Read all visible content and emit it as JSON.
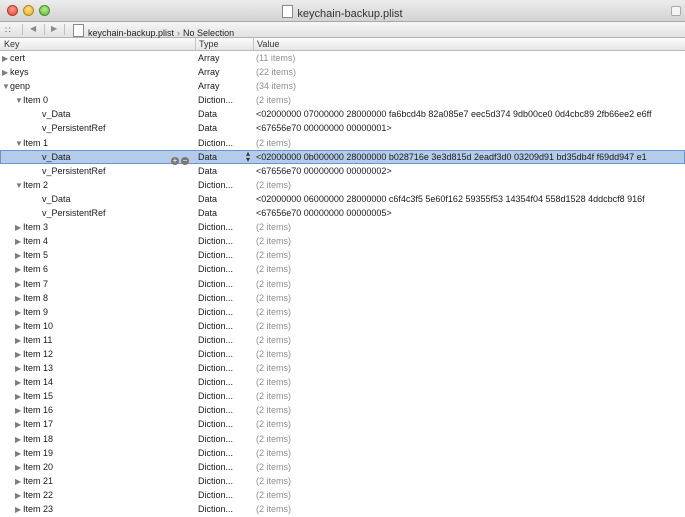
{
  "window": {
    "title": "keychain-backup.plist"
  },
  "jumpbar": {
    "filename": "keychain-backup.plist",
    "selection": "No Selection"
  },
  "columns": {
    "key": "Key",
    "type": "Type",
    "value": "Value"
  },
  "rows": [
    {
      "key": "cert",
      "type": "Array",
      "value": "(11 items)"
    },
    {
      "key": "keys",
      "type": "Array",
      "value": "(22 items)"
    },
    {
      "key": "genp",
      "type": "Array",
      "value": "(34 items)"
    },
    {
      "key": "Item 0",
      "type": "Diction...",
      "value": "(2 items)"
    },
    {
      "key": "v_Data",
      "type": "Data",
      "value": "<02000000 07000000 28000000 fa6bcd4b 82a085e7 eec5d374 9db00ce0 0d4cbc89 2fb66ee2 e6ff"
    },
    {
      "key": "v_PersistentRef",
      "type": "Data",
      "value": "<67656e70 00000000 00000001>"
    },
    {
      "key": "Item 1",
      "type": "Diction...",
      "value": "(2 items)"
    },
    {
      "key": "v_Data",
      "type": "Data",
      "value": "<02000000 0b000000 28000000 b028716e 3e3d815d 2eadf3d0 03209d91 bd35db4f f69dd947 e1"
    },
    {
      "key": "v_PersistentRef",
      "type": "Data",
      "value": "<67656e70 00000000 00000002>"
    },
    {
      "key": "Item 2",
      "type": "Diction...",
      "value": "(2 items)"
    },
    {
      "key": "v_Data",
      "type": "Data",
      "value": "<02000000 06000000 28000000 c6f4c3f5 5e60f162 59355f53 14354f04 558d1528 4ddcbcf8 916f"
    },
    {
      "key": "v_PersistentRef",
      "type": "Data",
      "value": "<67656e70 00000000 00000005>"
    },
    {
      "key": "Item 3",
      "type": "Diction...",
      "value": "(2 items)"
    },
    {
      "key": "Item 4",
      "type": "Diction...",
      "value": "(2 items)"
    },
    {
      "key": "Item 5",
      "type": "Diction...",
      "value": "(2 items)"
    },
    {
      "key": "Item 6",
      "type": "Diction...",
      "value": "(2 items)"
    },
    {
      "key": "Item 7",
      "type": "Diction...",
      "value": "(2 items)"
    },
    {
      "key": "Item 8",
      "type": "Diction...",
      "value": "(2 items)"
    },
    {
      "key": "Item 9",
      "type": "Diction...",
      "value": "(2 items)"
    },
    {
      "key": "Item 10",
      "type": "Diction...",
      "value": "(2 items)"
    },
    {
      "key": "Item 11",
      "type": "Diction...",
      "value": "(2 items)"
    },
    {
      "key": "Item 12",
      "type": "Diction...",
      "value": "(2 items)"
    },
    {
      "key": "Item 13",
      "type": "Diction...",
      "value": "(2 items)"
    },
    {
      "key": "Item 14",
      "type": "Diction...",
      "value": "(2 items)"
    },
    {
      "key": "Item 15",
      "type": "Diction...",
      "value": "(2 items)"
    },
    {
      "key": "Item 16",
      "type": "Diction...",
      "value": "(2 items)"
    },
    {
      "key": "Item 17",
      "type": "Diction...",
      "value": "(2 items)"
    },
    {
      "key": "Item 18",
      "type": "Diction...",
      "value": "(2 items)"
    },
    {
      "key": "Item 19",
      "type": "Diction...",
      "value": "(2 items)"
    },
    {
      "key": "Item 20",
      "type": "Diction...",
      "value": "(2 items)"
    },
    {
      "key": "Item 21",
      "type": "Diction...",
      "value": "(2 items)"
    },
    {
      "key": "Item 22",
      "type": "Diction...",
      "value": "(2 items)"
    },
    {
      "key": "Item 23",
      "type": "Diction...",
      "value": "(2 items)"
    }
  ],
  "icons": {
    "disclosure_collapsed": "disclosure-collapsed-icon",
    "disclosure_expanded": "disclosure-expanded-icon",
    "add_row": "add-row-icon",
    "remove_row": "remove-row-icon"
  }
}
